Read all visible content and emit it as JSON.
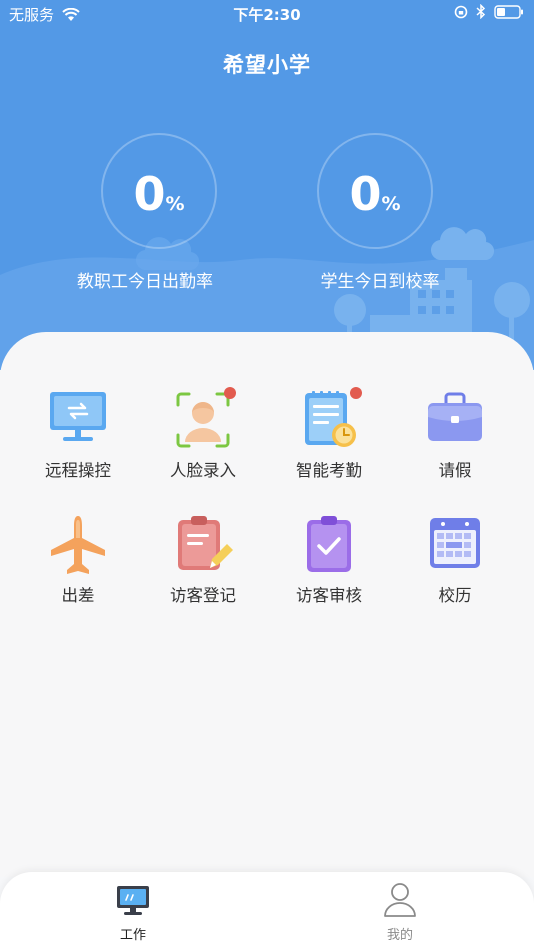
{
  "status_bar": {
    "carrier": "无服务",
    "time": "下午2:30"
  },
  "header": {
    "title": "希望小学"
  },
  "stats": [
    {
      "value": "0",
      "unit": "%",
      "label": "教职工今日出勤率"
    },
    {
      "value": "0",
      "unit": "%",
      "label": "学生今日到校率"
    }
  ],
  "grid": [
    {
      "label": "远程操控",
      "icon": "monitor-switch-icon",
      "badge": false
    },
    {
      "label": "人脸录入",
      "icon": "face-scan-icon",
      "badge": true
    },
    {
      "label": "智能考勤",
      "icon": "attendance-clock-icon",
      "badge": true
    },
    {
      "label": "请假",
      "icon": "briefcase-icon",
      "badge": false
    },
    {
      "label": "出差",
      "icon": "airplane-icon",
      "badge": false
    },
    {
      "label": "访客登记",
      "icon": "clipboard-edit-icon",
      "badge": false
    },
    {
      "label": "访客审核",
      "icon": "clipboard-check-icon",
      "badge": false
    },
    {
      "label": "校历",
      "icon": "calendar-icon",
      "badge": false
    }
  ],
  "tabbar": [
    {
      "label": "工作",
      "icon": "desktop-icon",
      "active": true
    },
    {
      "label": "我的",
      "icon": "user-icon",
      "active": false
    }
  ],
  "colors": {
    "primary": "#5399e6",
    "badge": "#e25b4f",
    "tab_active": "#222222",
    "tab_inactive": "#8a8a8a"
  }
}
